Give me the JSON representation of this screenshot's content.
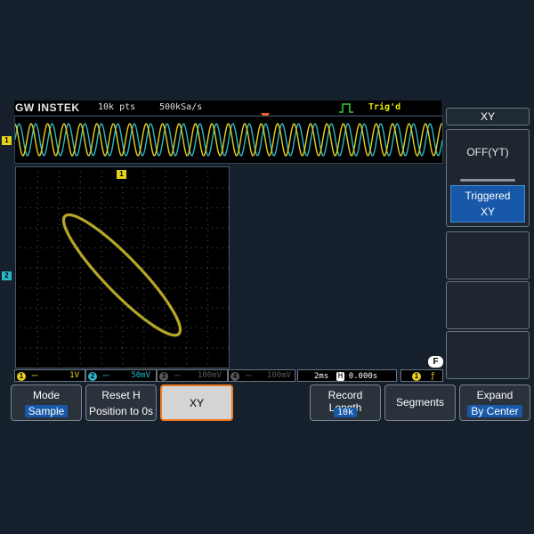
{
  "header": {
    "brand": "GW INSTEK",
    "record_points": "10k pts",
    "sample_rate": "500kSa/s",
    "trigger_status": "Trig'd"
  },
  "channels": {
    "ch1_marker": "1",
    "ch2_marker": "2"
  },
  "info_bar": {
    "ch1": {
      "num": "1",
      "coupling": "⎓",
      "scale": "1V",
      "color": "#e6d21e"
    },
    "ch2": {
      "num": "2",
      "coupling": "⎓",
      "scale": "50mV",
      "color": "#2ab8c8"
    },
    "ch3": {
      "num": "3",
      "coupling": "⎓",
      "scale": "100mV",
      "color": "#5a5a5a"
    },
    "ch4": {
      "num": "4",
      "coupling": "⎓",
      "scale": "100mV",
      "color": "#5a5a5a"
    },
    "timebase": "2ms",
    "h_label": "H",
    "h_position": "0.000s",
    "trig_source": "1",
    "trig_slope": "ƒ"
  },
  "f_icon": "F",
  "side_menu": {
    "title": "XY",
    "option_off": "OFF(YT)",
    "option_triggered_line1": "Triggered",
    "option_triggered_line2": "XY"
  },
  "softkeys": {
    "mode": {
      "label": "Mode",
      "value": "Sample"
    },
    "reset_h": {
      "line1": "Reset H",
      "line2": "Position to 0s"
    },
    "xy": {
      "label": "XY"
    },
    "record_length": {
      "label": "Record Length",
      "value": "10k"
    },
    "segments": {
      "label": "Segments"
    },
    "expand": {
      "label": "Expand",
      "value": "By Center"
    }
  },
  "colors": {
    "ch1": "#e6d21e",
    "ch2": "#2ab8c8",
    "accent": "#f07820",
    "menu_highlight": "#1858a8"
  }
}
